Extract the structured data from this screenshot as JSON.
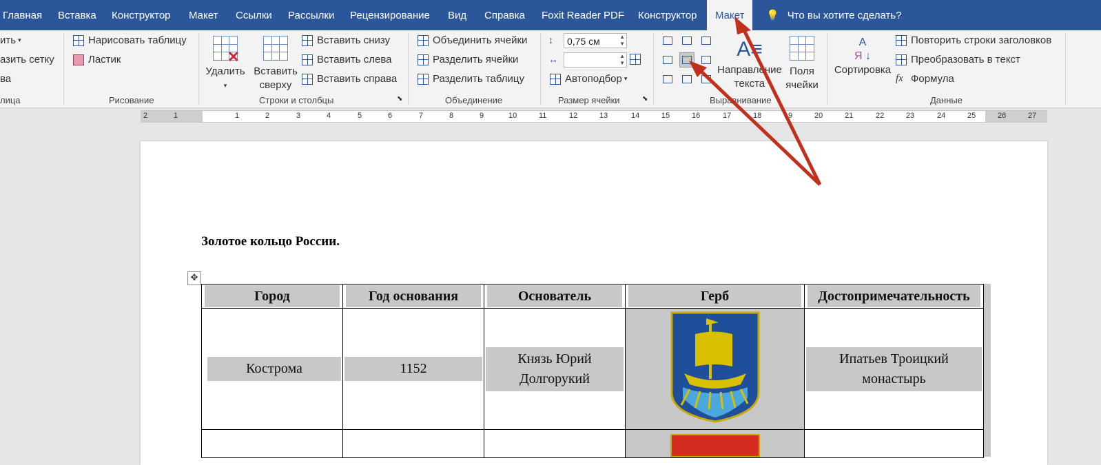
{
  "tabs": [
    {
      "label": "Главная"
    },
    {
      "label": "Вставка"
    },
    {
      "label": "Конструктор"
    },
    {
      "label": "Макет"
    },
    {
      "label": "Ссылки"
    },
    {
      "label": "Рассылки"
    },
    {
      "label": "Рецензирование"
    },
    {
      "label": "Вид"
    },
    {
      "label": "Справка"
    },
    {
      "label": "Foxit Reader PDF"
    },
    {
      "label": "Конструктор"
    },
    {
      "label": "Макет"
    }
  ],
  "tell_me": "Что вы хотите сделать?",
  "ribbon": {
    "table_group": {
      "partial1": "ить",
      "partial2": "азить сетку",
      "partial3": "ва",
      "label": "лица"
    },
    "draw": {
      "draw_table": "Нарисовать таблицу",
      "eraser": "Ластик",
      "label": "Рисование"
    },
    "rows_cols": {
      "delete": "Удалить",
      "insert_above_1": "Вставить",
      "insert_above_2": "сверху",
      "insert_below": "Вставить снизу",
      "insert_left": "Вставить слева",
      "insert_right": "Вставить справа",
      "label": "Строки и столбцы"
    },
    "merge": {
      "merge_cells": "Объединить ячейки",
      "split_cells": "Разделить ячейки",
      "split_table": "Разделить таблицу",
      "label": "Объединение"
    },
    "cell_size": {
      "height": "0,75 см",
      "width": "",
      "autofit": "Автоподбор",
      "label": "Размер ячейки"
    },
    "alignment": {
      "direction_1": "Направление",
      "direction_2": "текста",
      "margins_1": "Поля",
      "margins_2": "ячейки",
      "label": "Выравнивание"
    },
    "data": {
      "sort": "Сортировка",
      "repeat_header": "Повторить строки заголовков",
      "convert": "Преобразовать в текст",
      "formula": "Формула",
      "label": "Данные"
    }
  },
  "ruler": [
    "2",
    "1",
    "1",
    "2",
    "3",
    "4",
    "5",
    "6",
    "7",
    "8",
    "9",
    "10",
    "11",
    "12",
    "13",
    "14",
    "15",
    "16",
    "17",
    "18",
    "19",
    "20",
    "21",
    "22",
    "23",
    "24",
    "25",
    "26",
    "27"
  ],
  "document": {
    "title": "Золотое кольцо России.",
    "headers": [
      "Город",
      "Год основания",
      "Основатель",
      "Герб",
      "Достопримечательность"
    ],
    "rows": [
      {
        "city": "Кострома",
        "year": "1152",
        "founder_1": "Князь Юрий",
        "founder_2": "Долгорукий",
        "sight_1": "Ипатьев Троицкий",
        "sight_2": "монастырь"
      }
    ]
  },
  "colors": {
    "accent": "#2b579a",
    "arrow": "#c0301c",
    "shading": "#c8c8c8"
  }
}
